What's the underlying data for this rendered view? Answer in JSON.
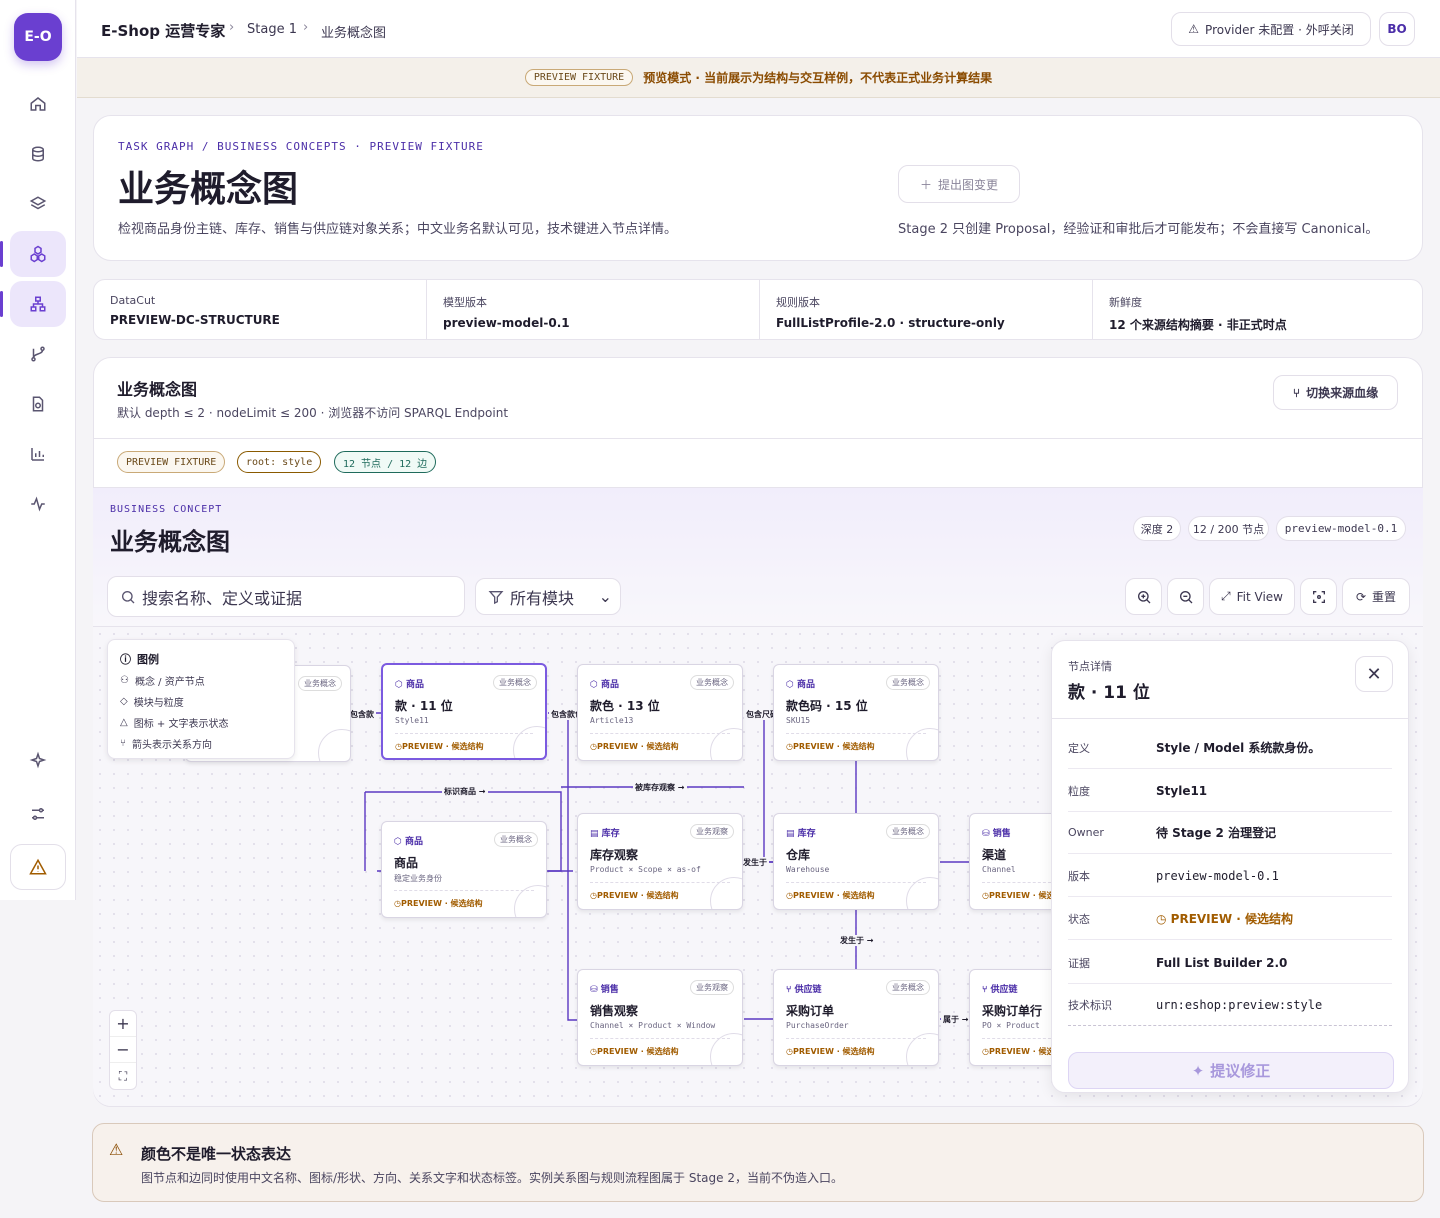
{
  "app": {
    "logo": "E-O",
    "name": "E-Shop 运营专家"
  },
  "breadcrumb": [
    "Stage 1",
    "业务概念图"
  ],
  "provider_status": "Provider 未配置 · 外呼关闭",
  "user_initials": "BO",
  "banner": {
    "pill": "PREVIEW FIXTURE",
    "text": "预览模式 · 当前展示为结构与交互样例，不代表正式业务计算结果"
  },
  "nav": {
    "icons": [
      "home-icon",
      "database-icon",
      "layers-icon",
      "concept-graph-icon",
      "hierarchy-icon",
      "branch-icon",
      "clock-file-icon",
      "chart-icon",
      "pulse-icon"
    ],
    "active": [
      "concept-graph-icon",
      "hierarchy-icon"
    ],
    "bottom": [
      "sparkle-icon",
      "settings-sliders-icon",
      "warning-icon"
    ]
  },
  "header": {
    "eyebrow": "TASK GRAPH / BUSINESS CONCEPTS · PREVIEW FIXTURE",
    "title": "业务概念图",
    "desc": "检视商品身份主链、库存、销售与供应链对象关系；中文业务名默认可见，技术键进入节点详情。",
    "proposal_button": "提出图变更",
    "stage_note": "Stage 2 只创建 Proposal，经验证和审批后才可能发布；不会直接写 Canonical。"
  },
  "meta": [
    {
      "k": "DataCut",
      "v": "PREVIEW-DC-STRUCTURE"
    },
    {
      "k": "模型版本",
      "v": "preview-model-0.1"
    },
    {
      "k": "规则版本",
      "v": "FullListProfile-2.0 · structure-only"
    },
    {
      "k": "新鲜度",
      "v": "12 个来源结构摘要 · 非正式时点"
    }
  ],
  "graph_section": {
    "title": "业务概念图",
    "desc": "默认 depth ≤ 2 · nodeLimit ≤ 200 · 浏览器不访问 SPARQL Endpoint",
    "switch_button": "切换来源血缘",
    "tags": [
      "PREVIEW FIXTURE",
      "root: style",
      "12 节点 / 12 边"
    ]
  },
  "viewer": {
    "eyebrow": "BUSINESS CONCEPT",
    "title": "业务概念图",
    "chips": [
      "深度 2",
      "12 / 200 节点",
      "preview-model-0.1"
    ],
    "search_placeholder": "搜索名称、定义或证据",
    "module_filter": "所有模块",
    "fit_view": "Fit View",
    "reset": "重置"
  },
  "legend": {
    "title": "图例",
    "rows": [
      "概念 / 资产节点",
      "模块与粒度",
      "图标 + 文字表示状态",
      "箭头表示关系方向"
    ]
  },
  "status_text": "PREVIEW · 候选结构",
  "nodes": [
    {
      "id": "n0",
      "module": "",
      "kind": "业务概念",
      "name": "",
      "key": ""
    },
    {
      "id": "n1",
      "module": "商品",
      "kind": "业务概念",
      "name": "款 · 11 位",
      "key": "Style11"
    },
    {
      "id": "n2",
      "module": "商品",
      "kind": "业务概念",
      "name": "款色 · 13 位",
      "key": "Article13"
    },
    {
      "id": "n3",
      "module": "商品",
      "kind": "业务概念",
      "name": "款色码 · 15 位",
      "key": "SKU15"
    },
    {
      "id": "n4",
      "module": "商品",
      "kind": "业务概念",
      "name": "商品",
      "key": "稳定业务身份"
    },
    {
      "id": "n5",
      "module": "库存",
      "kind": "业务观察",
      "name": "库存观察",
      "key": "Product × Scope × as-of"
    },
    {
      "id": "n6",
      "module": "库存",
      "kind": "业务概念",
      "name": "仓库",
      "key": "Warehouse"
    },
    {
      "id": "n7",
      "module": "销售",
      "kind": "业务概念",
      "name": "渠道",
      "key": "Channel"
    },
    {
      "id": "n8",
      "module": "销售",
      "kind": "业务观察",
      "name": "销售观察",
      "key": "Channel × Product × Window"
    },
    {
      "id": "n9",
      "module": "供应链",
      "kind": "业务概念",
      "name": "采购订单",
      "key": "PurchaseOrder"
    },
    {
      "id": "n10",
      "module": "供应链",
      "kind": "业务概念",
      "name": "采购订单行",
      "key": "PO × Product"
    }
  ],
  "edges": [
    "包含款",
    "包含款色",
    "包含尺码",
    "标识商品 →",
    "被库存观察 →",
    "发生于",
    "发生于 →",
    "属于 →"
  ],
  "detail": {
    "eyebrow": "节点详情",
    "title": "款 · 11 位",
    "rows": [
      {
        "k": "定义",
        "v": "Style / Model 系统款身份。"
      },
      {
        "k": "粒度",
        "v": "Style11"
      },
      {
        "k": "Owner",
        "v": "待 Stage 2 治理登记"
      },
      {
        "k": "版本",
        "v": "preview-model-0.1"
      },
      {
        "k": "状态",
        "v": "PREVIEW · 候选结构"
      },
      {
        "k": "证据",
        "v": "Full List Builder 2.0"
      },
      {
        "k": "技术标识",
        "v": "urn:eshop:preview:style"
      }
    ],
    "action": "提议修正"
  },
  "note": {
    "title": "颜色不是唯一状态表达",
    "text": "图节点和边同时使用中文名称、图标/形状、方向、关系文字和状态标签。实例关系图与规则流程图属于 Stage 2，当前不伪造入口。"
  },
  "colors": {
    "accent": "#6a3fd0",
    "preview": "#a15c00",
    "teal": "#1f6b5c"
  }
}
